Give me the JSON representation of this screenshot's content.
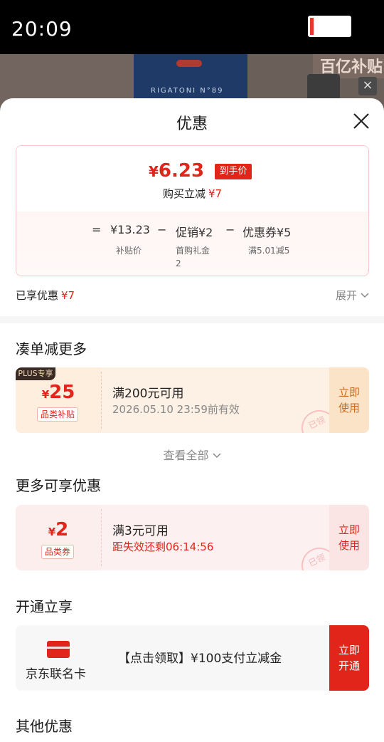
{
  "status_bar": {
    "time": "20:09"
  },
  "background": {
    "product_name": "RIGATONI N°89",
    "banner_text": "百亿补贴"
  },
  "sheet": {
    "title": "优惠",
    "price_summary": {
      "currency": "¥",
      "final_price": "6.23",
      "final_tag": "到手价",
      "reduce_label": "购买立减",
      "reduce_amount": "¥7",
      "formula": {
        "eq": "=",
        "subsidy_price": "¥13.23",
        "subsidy_label": "补贴价",
        "minus1": "−",
        "promo": "促销¥2",
        "promo_sub1": "首购礼金",
        "promo_sub2": "2",
        "minus2": "−",
        "coupon": "优惠券¥5",
        "coupon_sub": "满5.01减5"
      }
    },
    "enjoyed": {
      "label": "已享优惠",
      "amount": "¥7",
      "expand": "展开"
    },
    "section_more_reduce": "凑单减更多",
    "coupon1": {
      "badge": "PLUS专享",
      "currency": "¥",
      "amount": "25",
      "category": "品类补贴",
      "condition": "满200元可用",
      "validity": "2026.05.10 23:59前有效",
      "action": [
        "立即",
        "使用"
      ],
      "stamp": "已领"
    },
    "view_all": "查看全部",
    "section_more_offers": "更多可享优惠",
    "coupon2": {
      "currency": "¥",
      "amount": "2",
      "category": "品类券",
      "condition": "满3元可用",
      "validity": "距失效还剩06:14:56",
      "action": [
        "立即",
        "使用"
      ],
      "stamp": "已领"
    },
    "section_open": "开通立享",
    "card_offer": {
      "card_name": "京东联名卡",
      "text": "【点击领取】¥100支付立减金",
      "action": [
        "立即",
        "开通"
      ]
    },
    "section_other": "其他优惠"
  },
  "colors": {
    "accent": "#e1251b",
    "coupon1_bg": "#fdf0e4",
    "coupon2_bg": "#fdf0f0"
  }
}
